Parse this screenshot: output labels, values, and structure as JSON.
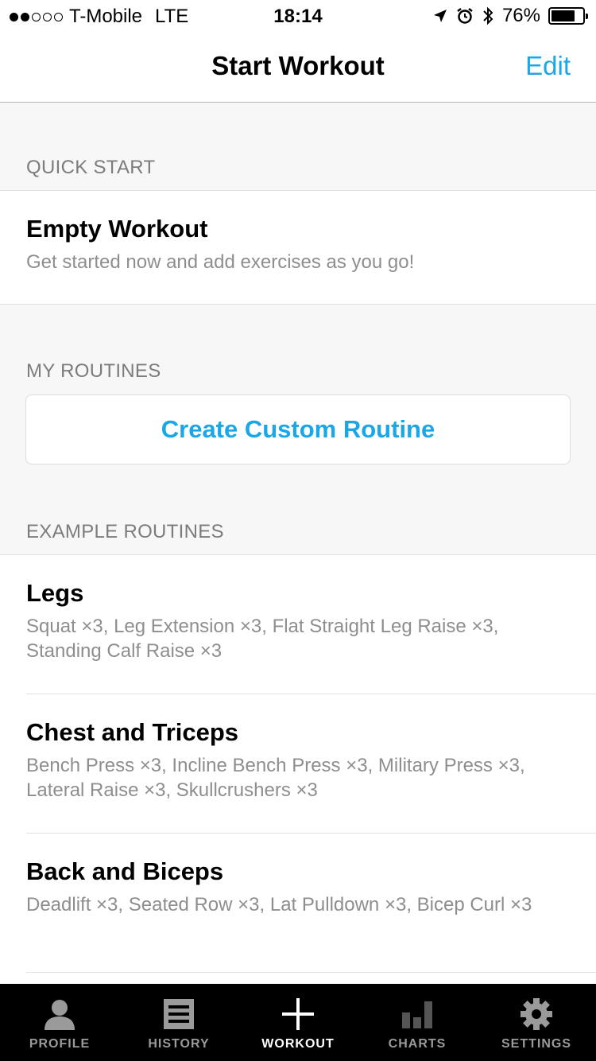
{
  "status_bar": {
    "carrier": "T-Mobile",
    "network": "LTE",
    "time": "18:14",
    "battery_percent": "76%",
    "battery_level": 0.76,
    "signal_bars_filled": 2,
    "signal_bars_total": 5
  },
  "nav": {
    "title": "Start Workout",
    "edit_label": "Edit"
  },
  "quick_start": {
    "header": "QUICK START",
    "empty_workout_title": "Empty Workout",
    "empty_workout_subtitle": "Get started now and add exercises as you go!"
  },
  "my_routines": {
    "header": "MY ROUTINES",
    "create_label": "Create Custom Routine"
  },
  "example_routines": {
    "header": "EXAMPLE ROUTINES",
    "items": [
      {
        "title": "Legs",
        "exercises": "Squat ×3, Leg Extension ×3, Flat Straight Leg Raise ×3, Standing Calf Raise ×3"
      },
      {
        "title": "Chest and Triceps",
        "exercises": "Bench Press ×3, Incline Bench Press ×3, Military Press ×3, Lateral Raise ×3, Skullcrushers ×3"
      },
      {
        "title": "Back and Biceps",
        "exercises": "Deadlift ×3, Seated Row ×3, Lat Pulldown ×3, Bicep Curl ×3"
      }
    ]
  },
  "tab_bar": {
    "tabs": [
      {
        "label": "PROFILE",
        "icon": "profile-icon"
      },
      {
        "label": "HISTORY",
        "icon": "history-icon"
      },
      {
        "label": "WORKOUT",
        "icon": "plus-icon"
      },
      {
        "label": "CHARTS",
        "icon": "charts-icon"
      },
      {
        "label": "SETTINGS",
        "icon": "gear-icon"
      }
    ],
    "active_index": 2
  },
  "colors": {
    "accent": "#1aa7e8",
    "tab_background": "#000000",
    "inactive_tab": "#9a9a9a"
  }
}
